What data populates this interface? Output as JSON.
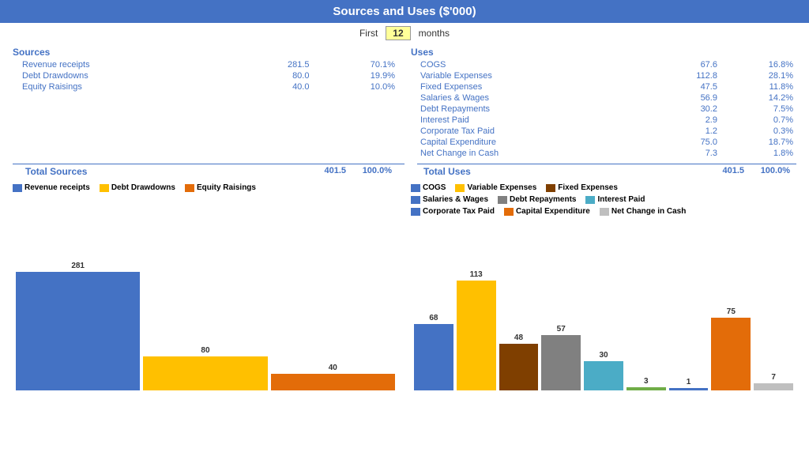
{
  "header": {
    "title": "Sources and Uses ($'000)",
    "first_label": "First",
    "months_value": "12",
    "months_label": "months"
  },
  "sources": {
    "title": "Sources",
    "items": [
      {
        "label": "Revenue receipts",
        "value": "281.5",
        "pct": "70.1%"
      },
      {
        "label": "Debt Drawdowns",
        "value": "80.0",
        "pct": "19.9%"
      },
      {
        "label": "Equity Raisings",
        "value": "40.0",
        "pct": "10.0%"
      }
    ],
    "total_label": "Total Sources",
    "total_value": "401.5",
    "total_pct": "100.0%"
  },
  "uses": {
    "title": "Uses",
    "items": [
      {
        "label": "COGS",
        "value": "67.6",
        "pct": "16.8%"
      },
      {
        "label": "Variable Expenses",
        "value": "112.8",
        "pct": "28.1%"
      },
      {
        "label": "Fixed Expenses",
        "value": "47.5",
        "pct": "11.8%"
      },
      {
        "label": "Salaries & Wages",
        "value": "56.9",
        "pct": "14.2%"
      },
      {
        "label": "Debt Repayments",
        "value": "30.2",
        "pct": "7.5%"
      },
      {
        "label": "Interest Paid",
        "value": "2.9",
        "pct": "0.7%"
      },
      {
        "label": "Corporate Tax Paid",
        "value": "1.2",
        "pct": "0.3%"
      },
      {
        "label": "Capital Expenditure",
        "value": "75.0",
        "pct": "18.7%"
      },
      {
        "label": "Net Change in Cash",
        "value": "7.3",
        "pct": "1.8%"
      }
    ],
    "total_label": "Total Uses",
    "total_value": "401.5",
    "total_pct": "100.0%"
  },
  "left_chart": {
    "legend": [
      {
        "label": "Revenue receipts",
        "color": "#4472C4"
      },
      {
        "label": "Debt Drawdowns",
        "color": "#FFC000"
      },
      {
        "label": "Equity Raisings",
        "color": "#E36C09"
      }
    ],
    "bars": [
      {
        "label": "281",
        "value": 281,
        "color": "#4472C4"
      },
      {
        "label": "80",
        "value": 80,
        "color": "#FFC000"
      },
      {
        "label": "40",
        "value": 40,
        "color": "#E36C09"
      }
    ]
  },
  "right_chart": {
    "legend": [
      {
        "label": "COGS",
        "color": "#4472C4"
      },
      {
        "label": "Variable Expenses",
        "color": "#FFC000"
      },
      {
        "label": "Fixed Expenses",
        "color": "#7F3F00"
      },
      {
        "label": "Salaries & Wages",
        "color": "#4472C4"
      },
      {
        "label": "Debt Repayments",
        "color": "#808080"
      },
      {
        "label": "Interest Paid",
        "color": "#4BACC6"
      },
      {
        "label": "Corporate Tax Paid",
        "color": "#4472C4"
      },
      {
        "label": "Capital Expenditure",
        "color": "#E36C09"
      },
      {
        "label": "Net Change in Cash",
        "color": "#BFBFBF"
      }
    ],
    "bars": [
      {
        "label": "68",
        "value": 68,
        "color": "#4472C4"
      },
      {
        "label": "113",
        "value": 113,
        "color": "#FFC000"
      },
      {
        "label": "48",
        "value": 48,
        "color": "#7F3F00"
      },
      {
        "label": "57",
        "value": 57,
        "color": "#808080"
      },
      {
        "label": "30",
        "value": 30,
        "color": "#4BACC6"
      },
      {
        "label": "3",
        "value": 3,
        "color": "#70AD47"
      },
      {
        "label": "1",
        "value": 1,
        "color": "#4472C4"
      },
      {
        "label": "75",
        "value": 75,
        "color": "#E36C09"
      },
      {
        "label": "7",
        "value": 7,
        "color": "#BFBFBF"
      }
    ]
  }
}
